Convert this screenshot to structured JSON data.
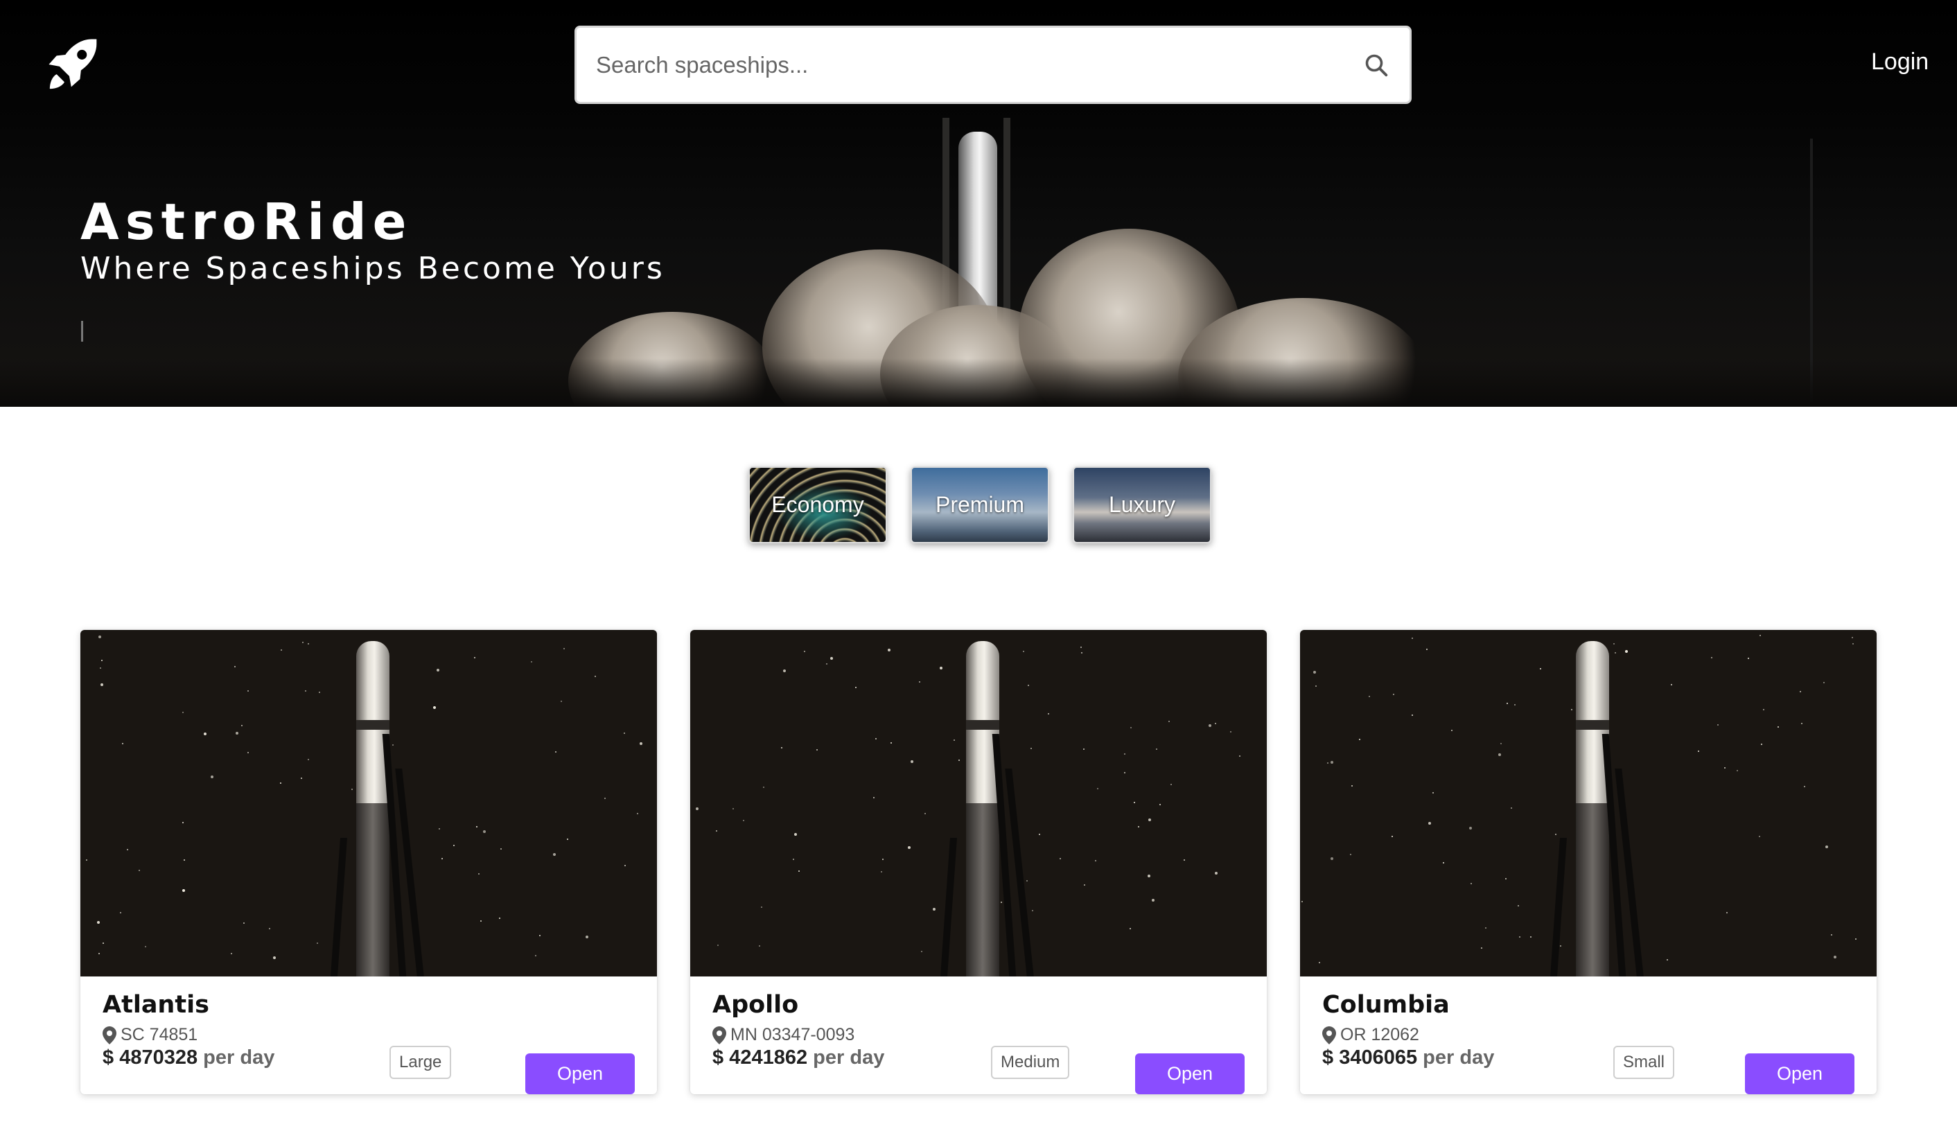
{
  "header": {
    "logo_icon": "rocket-icon",
    "search": {
      "placeholder": "Search spaceships...",
      "value": "",
      "icon": "search-icon"
    },
    "login_label": "Login"
  },
  "hero": {
    "title": "AstroRide",
    "tagline": "Where Spaceships Become Yours"
  },
  "categories": [
    {
      "label": "Economy"
    },
    {
      "label": "Premium"
    },
    {
      "label": "Luxury"
    }
  ],
  "ships": [
    {
      "name": "Atlantis",
      "location": "SC 74851",
      "currency": "$",
      "price": "4870328",
      "per": "per day",
      "size": "Large",
      "action": "Open"
    },
    {
      "name": "Apollo",
      "location": "MN 03347-0093",
      "currency": "$",
      "price": "4241862",
      "per": "per day",
      "size": "Medium",
      "action": "Open"
    },
    {
      "name": "Columbia",
      "location": "OR 12062",
      "currency": "$",
      "price": "3406065",
      "per": "per day",
      "size": "Small",
      "action": "Open"
    }
  ],
  "colors": {
    "accent": "#8a4dff",
    "hero_bg": "#000000"
  }
}
